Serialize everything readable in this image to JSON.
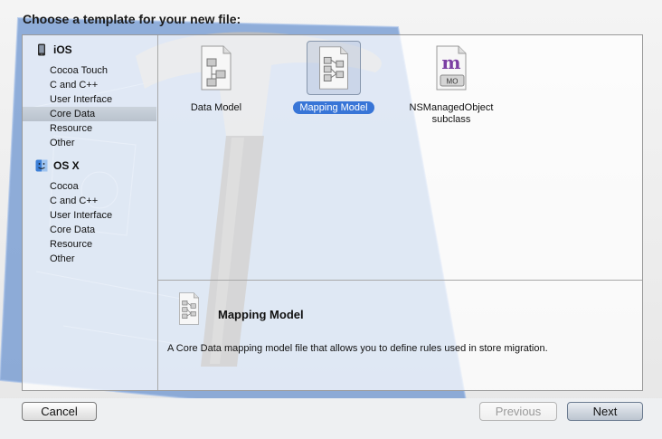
{
  "dialog": {
    "title": "Choose a template for your new file:"
  },
  "sidebar": {
    "groups": [
      {
        "name": "iOS",
        "icon": "ios-device-icon",
        "items": [
          {
            "label": "Cocoa Touch",
            "selected": false
          },
          {
            "label": "C and C++",
            "selected": false
          },
          {
            "label": "User Interface",
            "selected": false
          },
          {
            "label": "Core Data",
            "selected": true
          },
          {
            "label": "Resource",
            "selected": false
          },
          {
            "label": "Other",
            "selected": false
          }
        ]
      },
      {
        "name": "OS X",
        "icon": "mac-finder-icon",
        "items": [
          {
            "label": "Cocoa",
            "selected": false
          },
          {
            "label": "C and C++",
            "selected": false
          },
          {
            "label": "User Interface",
            "selected": false
          },
          {
            "label": "Core Data",
            "selected": false
          },
          {
            "label": "Resource",
            "selected": false
          },
          {
            "label": "Other",
            "selected": false
          }
        ]
      }
    ]
  },
  "templates": [
    {
      "label": "Data Model",
      "icon": "data-model-document-icon",
      "selected": false
    },
    {
      "label": "Mapping Model",
      "icon": "mapping-model-document-icon",
      "selected": true
    },
    {
      "label": "NSManagedObject subclass",
      "icon": "managed-object-source-icon",
      "icon_text": "m",
      "badge": "MO",
      "selected": false
    }
  ],
  "description": {
    "title": "Mapping Model",
    "text": "A Core Data mapping model file that allows you to define rules used in store migration.",
    "icon": "mapping-model-document-icon"
  },
  "buttons": {
    "cancel": "Cancel",
    "previous": "Previous",
    "next": "Next",
    "previous_enabled": false
  },
  "colors": {
    "selection_blue": "#3875d7",
    "sidebar_selection": "#c2cad4",
    "blueprint": "#5b86c6"
  }
}
